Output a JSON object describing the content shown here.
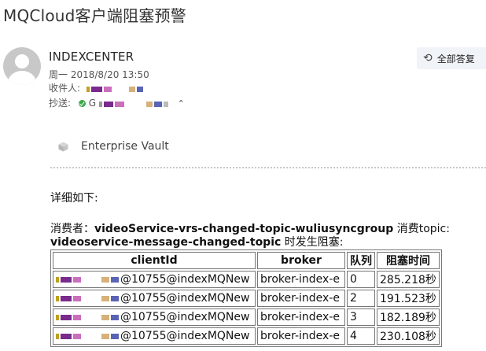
{
  "email": {
    "subject": "MQCloud客户端阻塞预警",
    "sender": "INDEXCENTER",
    "date": "周一 2018/8/20 13:50",
    "to_label": "收件人:",
    "cc_label": "抄送:",
    "cc_visible_text": "G"
  },
  "actions": {
    "reply_all_label": "全部答复"
  },
  "vault": {
    "label": "Enterprise Vault"
  },
  "body": {
    "intro": "详细如下:",
    "consumer_label": "消费者：",
    "consumer_name": "videoService-vrs-changed-topic-wuliusyncgroup",
    "topic_label": " 消费topic:",
    "topic_name": "videoservice-message-changed-topic",
    "suffix": " 时发生阻塞:"
  },
  "table": {
    "headers": [
      "clientId",
      "broker",
      "队列",
      "阻塞时间"
    ],
    "rows": [
      {
        "client_suffix": "@10755@indexMQNew",
        "broker": "broker-index-e",
        "queue": "0",
        "time": "285.218秒"
      },
      {
        "client_suffix": "@10755@indexMQNew",
        "broker": "broker-index-e",
        "queue": "2",
        "time": "191.523秒"
      },
      {
        "client_suffix": "@10755@indexMQNew",
        "broker": "broker-index-e",
        "queue": "3",
        "time": "182.189秒"
      },
      {
        "client_suffix": "@10755@indexMQNew",
        "broker": "broker-index-e",
        "queue": "4",
        "time": "230.108秒"
      }
    ]
  }
}
